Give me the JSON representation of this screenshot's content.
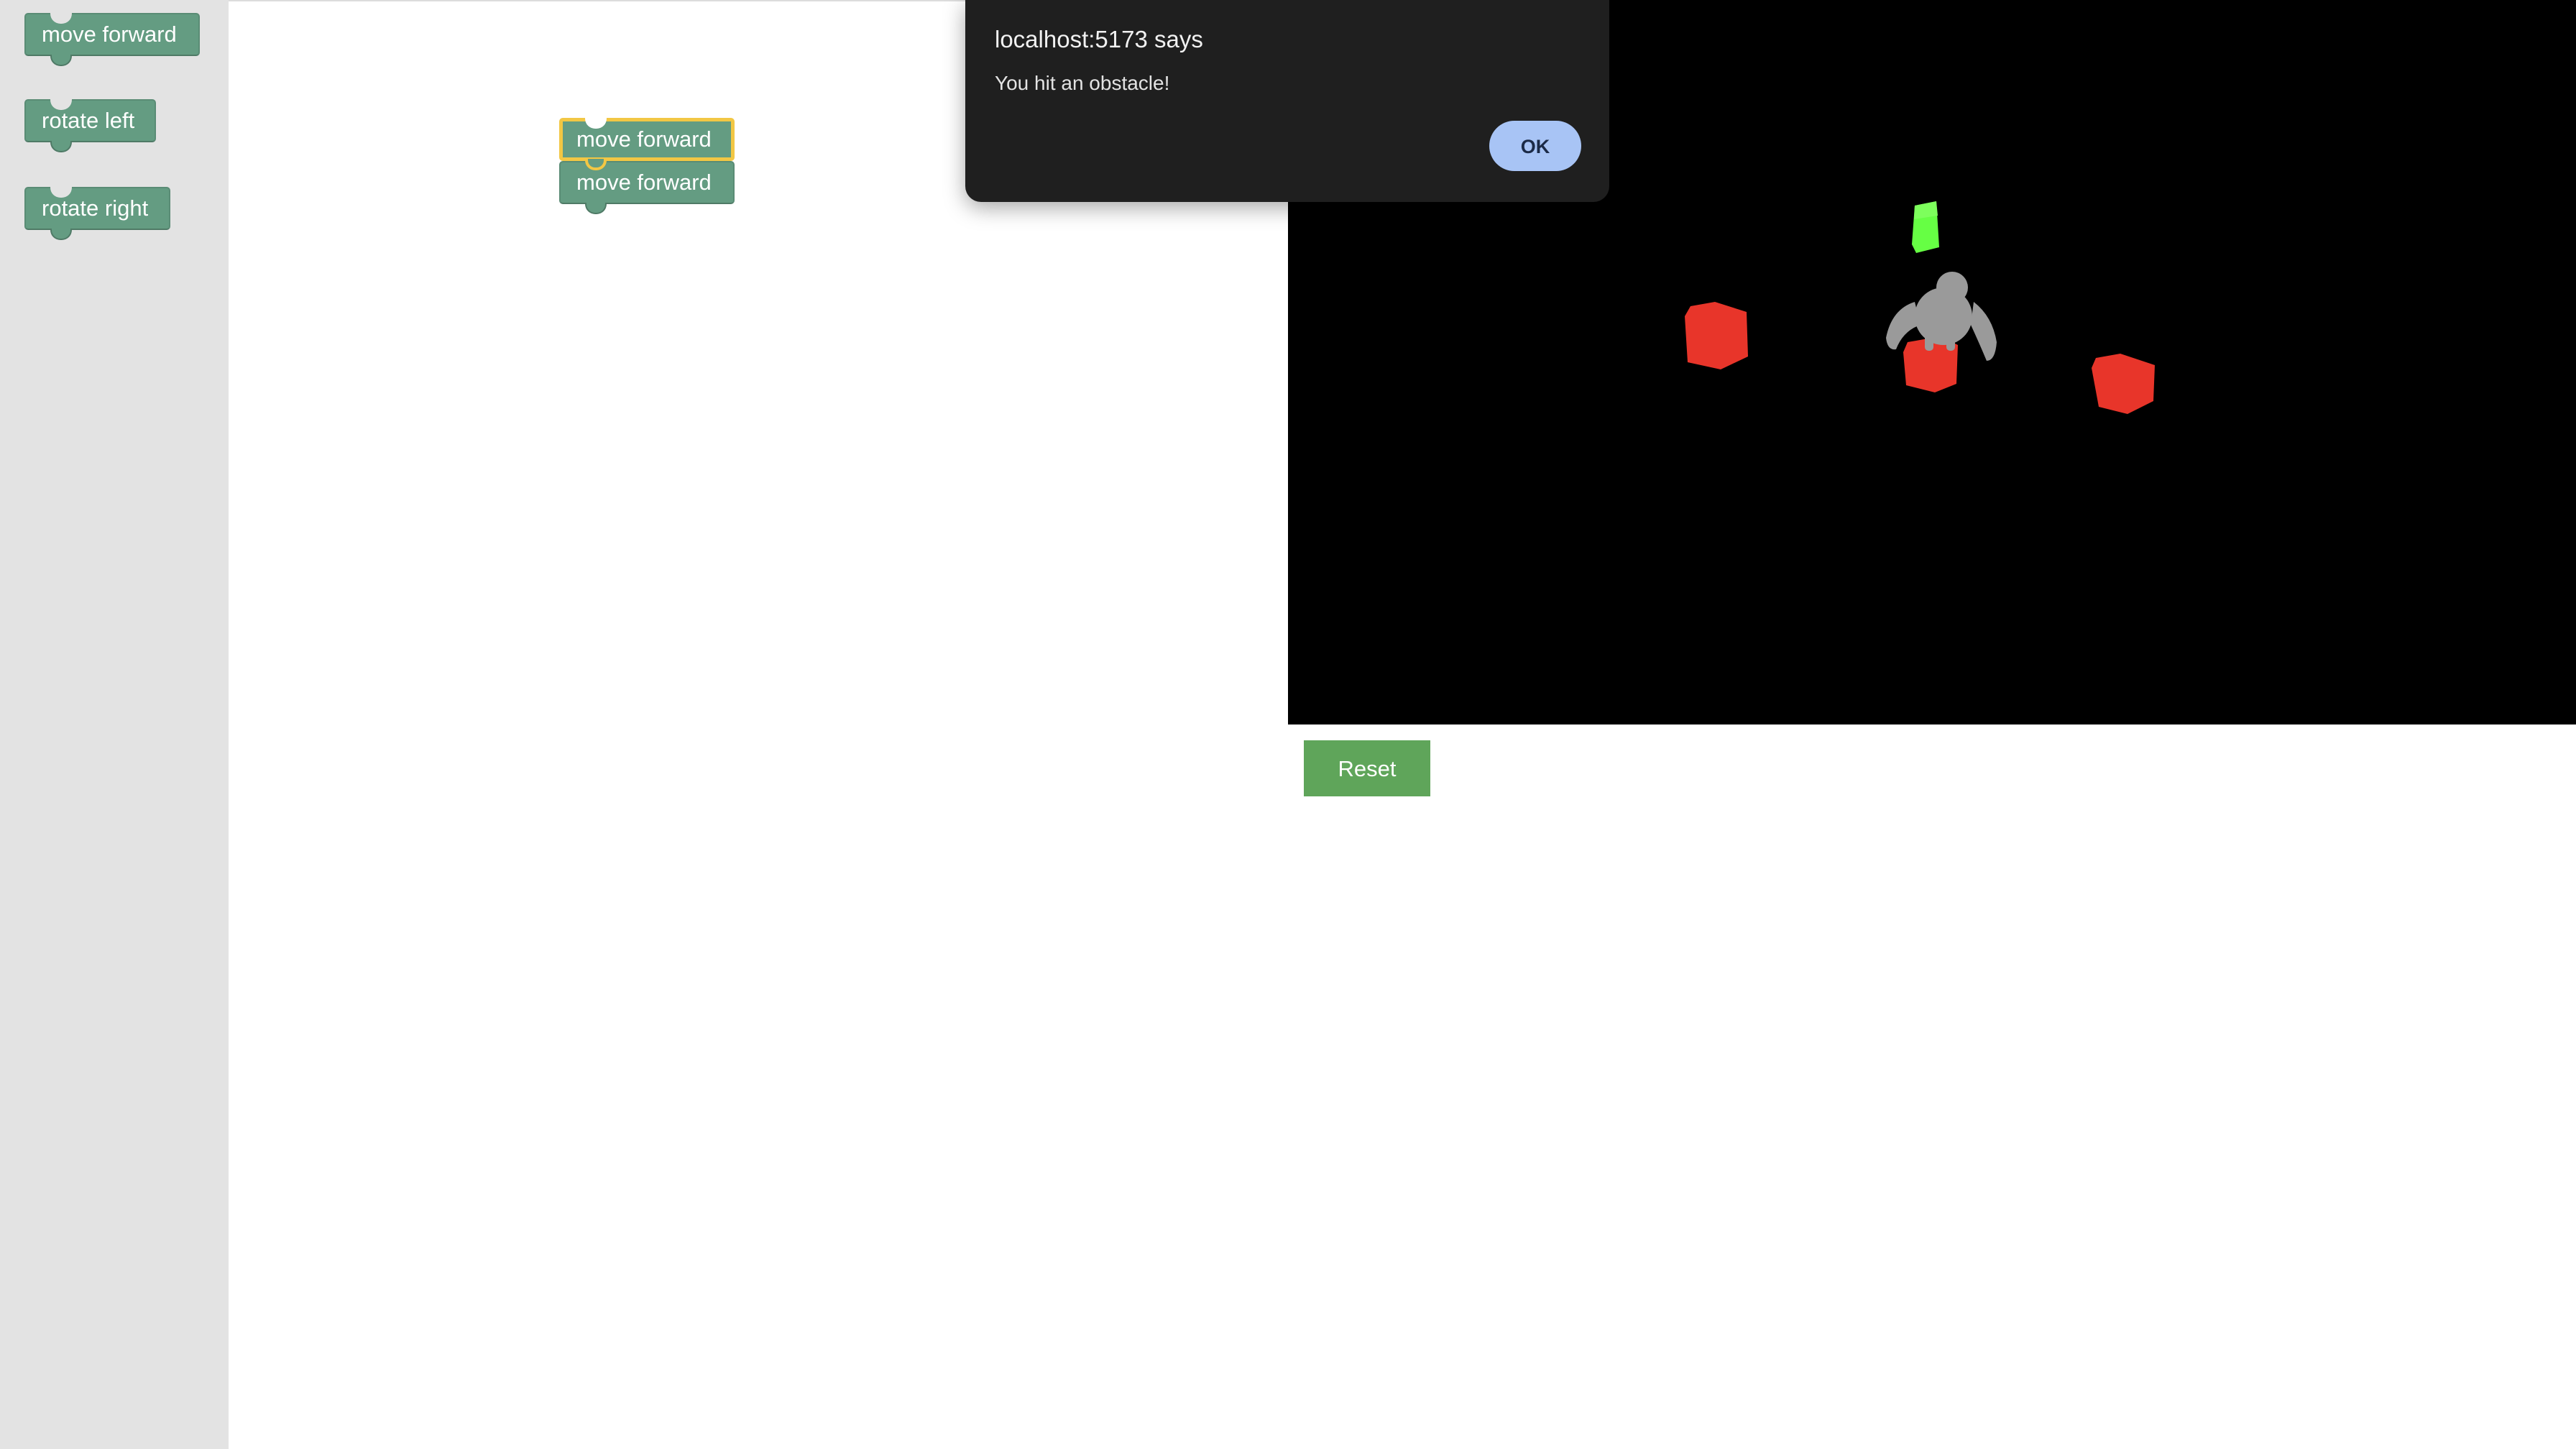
{
  "toolbox": {
    "blocks": [
      {
        "label": "move forward"
      },
      {
        "label": "rotate left"
      },
      {
        "label": "rotate right"
      }
    ]
  },
  "workspace": {
    "blocks": [
      {
        "label": "move forward",
        "selected": true
      },
      {
        "label": "move forward",
        "selected": false
      }
    ]
  },
  "scene": {
    "background_color": "#000000",
    "goal_color": "#66ff44",
    "obstacle_color": "#e8352a",
    "robot_color": "#9a9a9a",
    "obstacle_count": 3,
    "goal_count": 1
  },
  "controls": {
    "reset_label": "Reset",
    "reset_color": "#5fa55a"
  },
  "dialog": {
    "title": "localhost:5173 says",
    "message": "You hit an obstacle!",
    "ok_label": "OK"
  }
}
